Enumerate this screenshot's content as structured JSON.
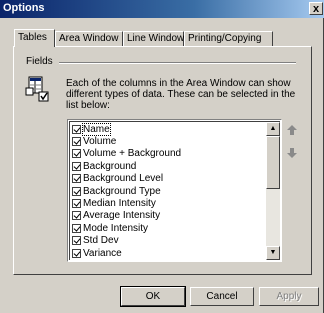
{
  "window": {
    "title": "Options",
    "close_glyph": "x"
  },
  "tabs": [
    {
      "label": "Tables",
      "active": true
    },
    {
      "label": "Area Window",
      "active": false
    },
    {
      "label": "Line Window",
      "active": false
    },
    {
      "label": "Printing/Copying",
      "active": false
    }
  ],
  "fields": {
    "group_label": "Fields",
    "description": "Each of the columns in the Area Window can show different types of data.  These can be selected in the list below:",
    "items": [
      {
        "label": "Name",
        "checked": true
      },
      {
        "label": "Volume",
        "checked": true
      },
      {
        "label": "Volume + Background",
        "checked": true
      },
      {
        "label": "Background",
        "checked": true
      },
      {
        "label": "Background Level",
        "checked": true
      },
      {
        "label": "Background Type",
        "checked": true
      },
      {
        "label": "Median Intensity",
        "checked": true
      },
      {
        "label": "Average Intensity",
        "checked": true
      },
      {
        "label": "Mode Intensity",
        "checked": true
      },
      {
        "label": "Std Dev",
        "checked": true
      },
      {
        "label": "Variance",
        "checked": true
      }
    ]
  },
  "icons": {
    "fields": "columns-checklist-icon",
    "move_up": "arrow-up-icon",
    "move_down": "arrow-down-icon",
    "scroll_up": "scroll-up-arrow-icon",
    "scroll_down": "scroll-down-arrow-icon"
  },
  "buttons": {
    "ok": "OK",
    "cancel": "Cancel",
    "apply": "Apply"
  },
  "colors": {
    "titlebar_start": "#0a246a",
    "titlebar_end": "#a6caf0",
    "face": "#d4d0c8"
  }
}
